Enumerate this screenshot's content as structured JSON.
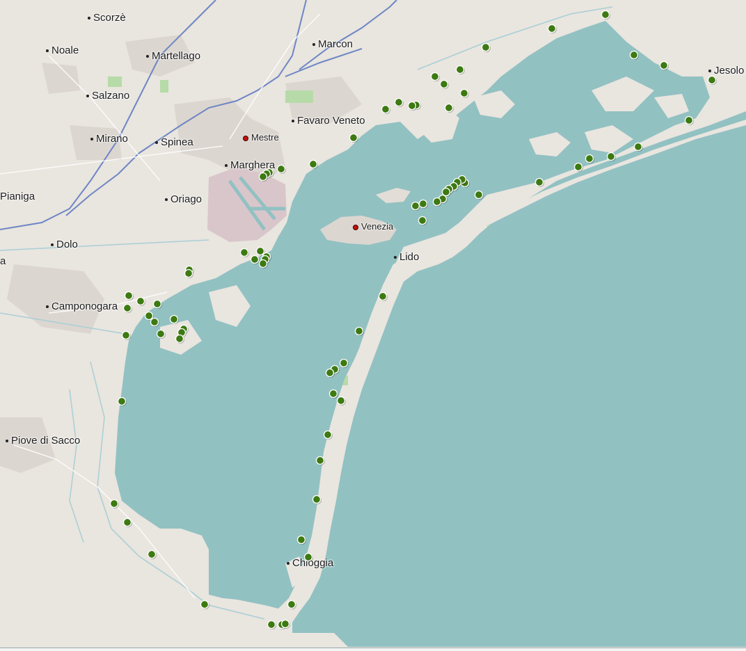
{
  "map": {
    "colors": {
      "land": "#e9e5df",
      "water": "#92c1c2",
      "urban": "#dcd6d0",
      "industrial": "#d9c6cb",
      "park": "#b7dba8",
      "motorway": "#6d86c4",
      "river": "#a8cfd6",
      "marker_fill": "#3d7a12",
      "marker_stroke": "#ffffff"
    },
    "places": [
      {
        "name": "Scorzè",
        "type": "town"
      },
      {
        "name": "Noale",
        "type": "town"
      },
      {
        "name": "Martellago",
        "type": "town"
      },
      {
        "name": "Marcon",
        "type": "town"
      },
      {
        "name": "Salzano",
        "type": "town"
      },
      {
        "name": "Mirano",
        "type": "town"
      },
      {
        "name": "Spinea",
        "type": "town"
      },
      {
        "name": "Mestre",
        "type": "city"
      },
      {
        "name": "Favaro Veneto",
        "type": "town"
      },
      {
        "name": "Marghera",
        "type": "town"
      },
      {
        "name": "Pianiga",
        "type": "town"
      },
      {
        "name": "Oriago",
        "type": "town"
      },
      {
        "name": "Venezia",
        "type": "city"
      },
      {
        "name": "Dolo",
        "type": "town"
      },
      {
        "name": "Lido",
        "type": "town"
      },
      {
        "name": "Camponogara",
        "type": "town"
      },
      {
        "name": "Piove di Sacco",
        "type": "town"
      },
      {
        "name": "Chioggia",
        "type": "town"
      },
      {
        "name": "Jesolo",
        "type": "town"
      },
      {
        "name": "a",
        "type": "fragment"
      }
    ],
    "marker_icon": "green-circle-marker"
  }
}
